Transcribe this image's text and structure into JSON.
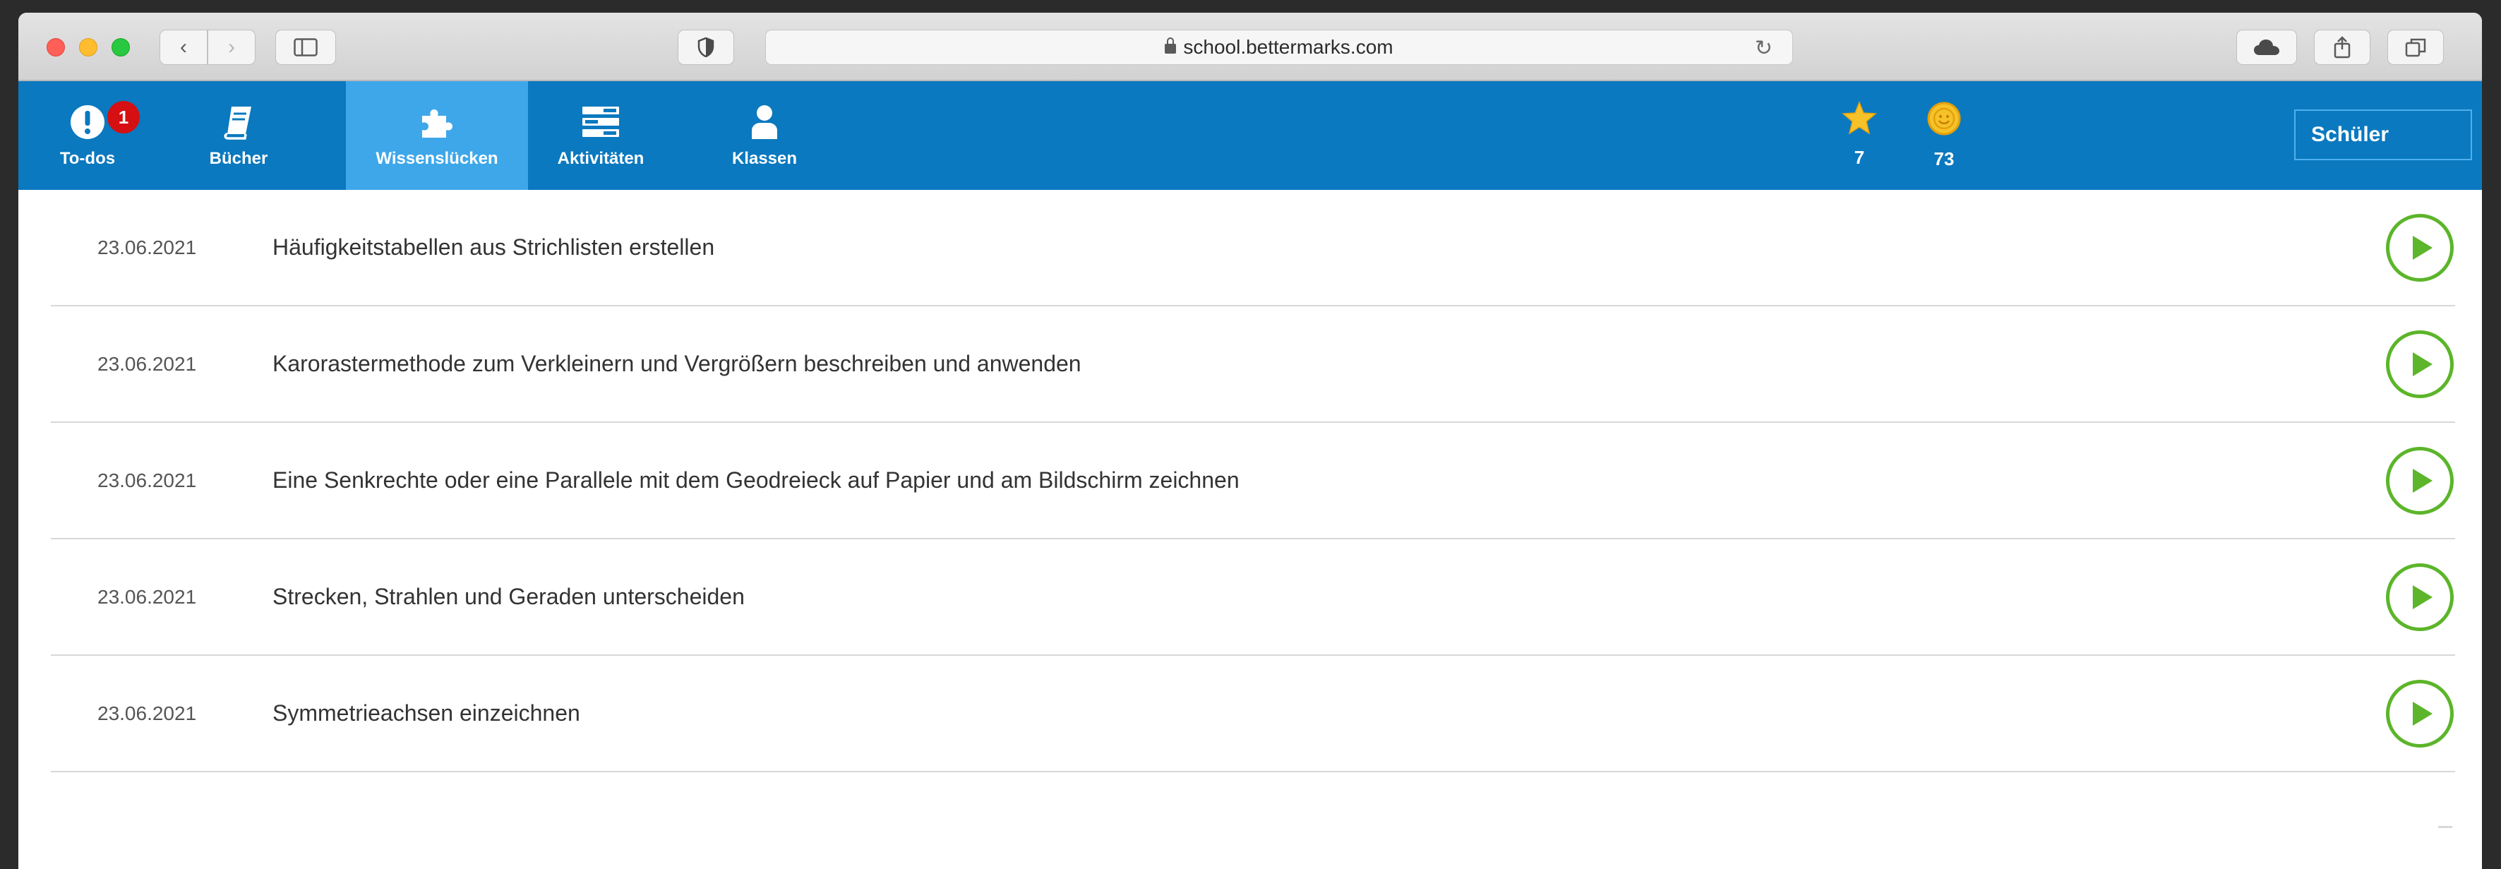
{
  "browser": {
    "url": "school.bettermarks.com",
    "back_glyph": "‹",
    "forward_glyph": "›",
    "reload_glyph": "↻"
  },
  "nav": {
    "items": [
      {
        "label": "To-dos",
        "icon": "exclamation-icon"
      },
      {
        "label": "Bücher",
        "icon": "book-icon"
      },
      {
        "label": "Wissenslücken",
        "icon": "puzzle-icon",
        "active": true
      },
      {
        "label": "Aktivitäten",
        "icon": "list-icon"
      },
      {
        "label": "Klassen",
        "icon": "person-icon"
      }
    ],
    "todo_badge": "1",
    "stars": "7",
    "coins": "73",
    "role": "Schüler"
  },
  "gaps": [
    {
      "date": "23.06.2021",
      "title": "Häufigkeitstabellen aus Strichlisten erstellen"
    },
    {
      "date": "23.06.2021",
      "title": "Karorastermethode zum Verkleinern und Vergrößern beschreiben und anwenden"
    },
    {
      "date": "23.06.2021",
      "title": "Eine Senkrechte oder eine Parallele mit dem Geodreieck auf Papier und am Bildschirm zeichnen"
    },
    {
      "date": "23.06.2021",
      "title": "Strecken, Strahlen und Geraden unterscheiden"
    },
    {
      "date": "23.06.2021",
      "title": "Symmetrieachsen einzeichnen"
    }
  ],
  "colors": {
    "nav_bg": "#0a79bf",
    "nav_active": "#3ea7ea",
    "badge": "#d50f12",
    "play": "#5cb52a",
    "star": "#f6c22a"
  }
}
